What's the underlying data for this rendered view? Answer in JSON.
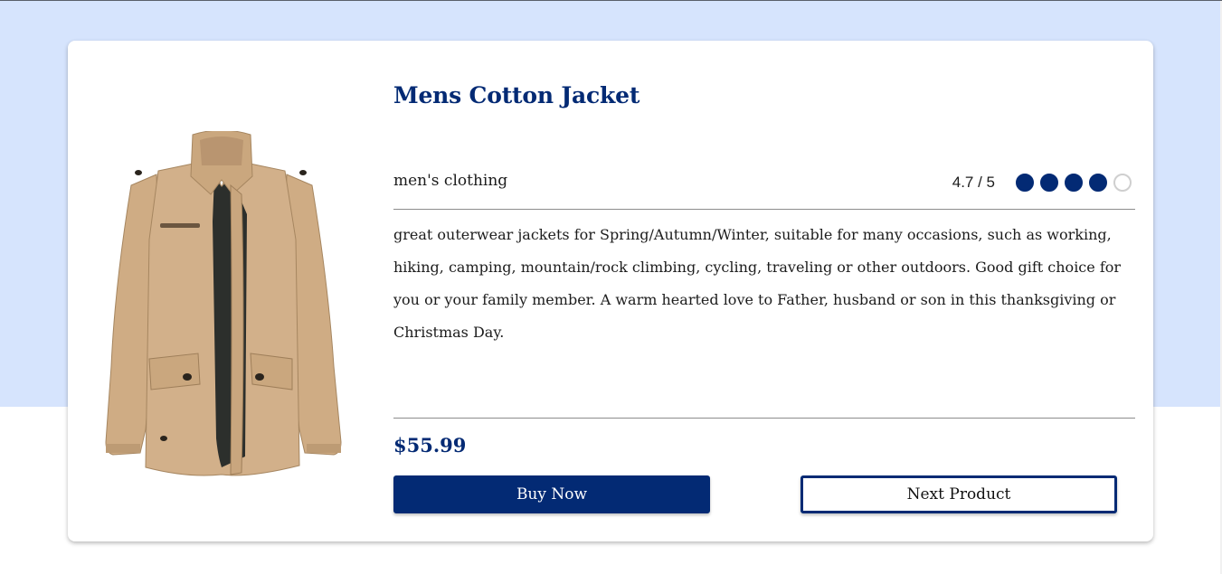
{
  "product": {
    "title": "Mens Cotton Jacket",
    "category": "men's clothing",
    "rating_text": "4.7 / 5",
    "rating_value": 4.7,
    "rating_max": 5,
    "filled_dots": 4,
    "description": "great outerwear jackets for Spring/Autumn/Winter, suitable for many occasions, such as working, hiking, camping, mountain/rock climbing, cycling, traveling or other outdoors. Good gift choice for you or your family member. A warm hearted love to Father, husband or son in this thanksgiving or Christmas Day.",
    "price": "$55.99",
    "image_icon": "jacket-image"
  },
  "actions": {
    "buy_label": "Buy Now",
    "next_label": "Next Product"
  },
  "colors": {
    "accent": "#032a74",
    "background_top": "#d6e4fd",
    "card": "#ffffff"
  }
}
